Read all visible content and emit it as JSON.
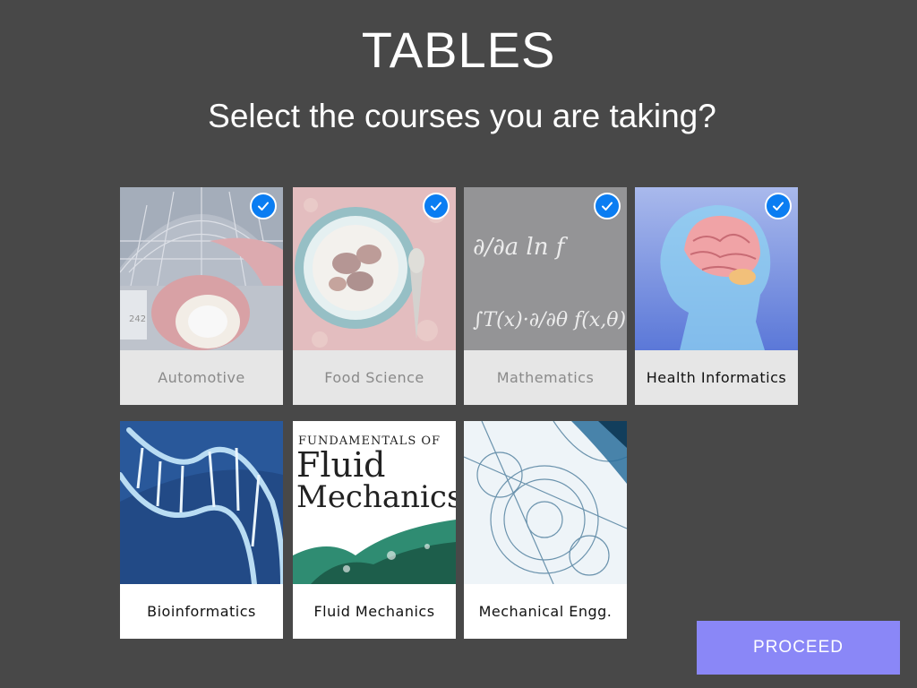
{
  "header": {
    "title": "TABLES",
    "subtitle": "Select the courses you are taking?"
  },
  "courses": [
    {
      "label": "Automotive",
      "selected": true,
      "icon": "car-image"
    },
    {
      "label": "Food Science",
      "selected": true,
      "icon": "food-plate-image"
    },
    {
      "label": "Mathematics",
      "selected": true,
      "icon": "formula-image"
    },
    {
      "label": "Health Informatics",
      "selected": true,
      "icon": "brain-image"
    },
    {
      "label": "Bioinformatics",
      "selected": false,
      "icon": "dna-image"
    },
    {
      "label": "Fluid Mechanics",
      "selected": false,
      "icon": "book-cover-image"
    },
    {
      "label": "Mechanical Engg.",
      "selected": false,
      "icon": "gears-sketch-image"
    }
  ],
  "book_cover": {
    "line1": "FUNDAMENTALS OF",
    "line2": "Fluid",
    "line3": "Mechanics"
  },
  "formula": {
    "line1": "∂/∂a ln f",
    "line2": "∫T(x)·∂/∂θ f(x,θ)"
  },
  "actions": {
    "proceed_label": "PROCEED"
  },
  "colors": {
    "background": "#484848",
    "accent": "#8a87f7",
    "check": "#0a7df2"
  }
}
